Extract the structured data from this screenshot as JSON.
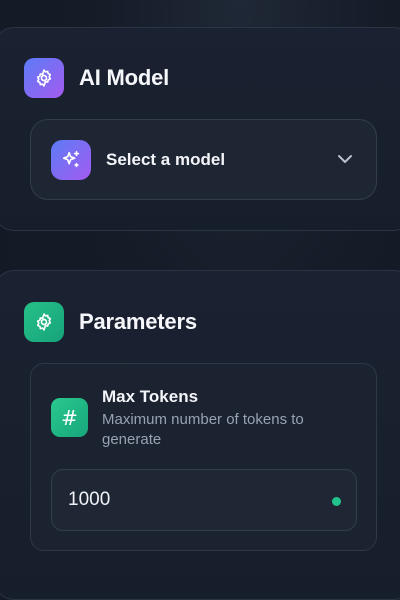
{
  "ai_model": {
    "title": "AI Model",
    "icon": "gear-icon",
    "select": {
      "label": "Select a model",
      "icon": "sparkles-icon",
      "chevron": "chevron-down-icon"
    }
  },
  "parameters": {
    "title": "Parameters",
    "icon": "gear-icon",
    "max_tokens": {
      "label": "Max Tokens",
      "description": "Maximum number of tokens to generate",
      "icon": "hash-icon",
      "icon_glyph": "#",
      "value": "1000",
      "status_color": "#21c48c"
    }
  },
  "colors": {
    "background": "#141a26",
    "accent_purple_start": "#5b7cf6",
    "accent_purple_end": "#a45bf0",
    "accent_green": "#27c089"
  }
}
